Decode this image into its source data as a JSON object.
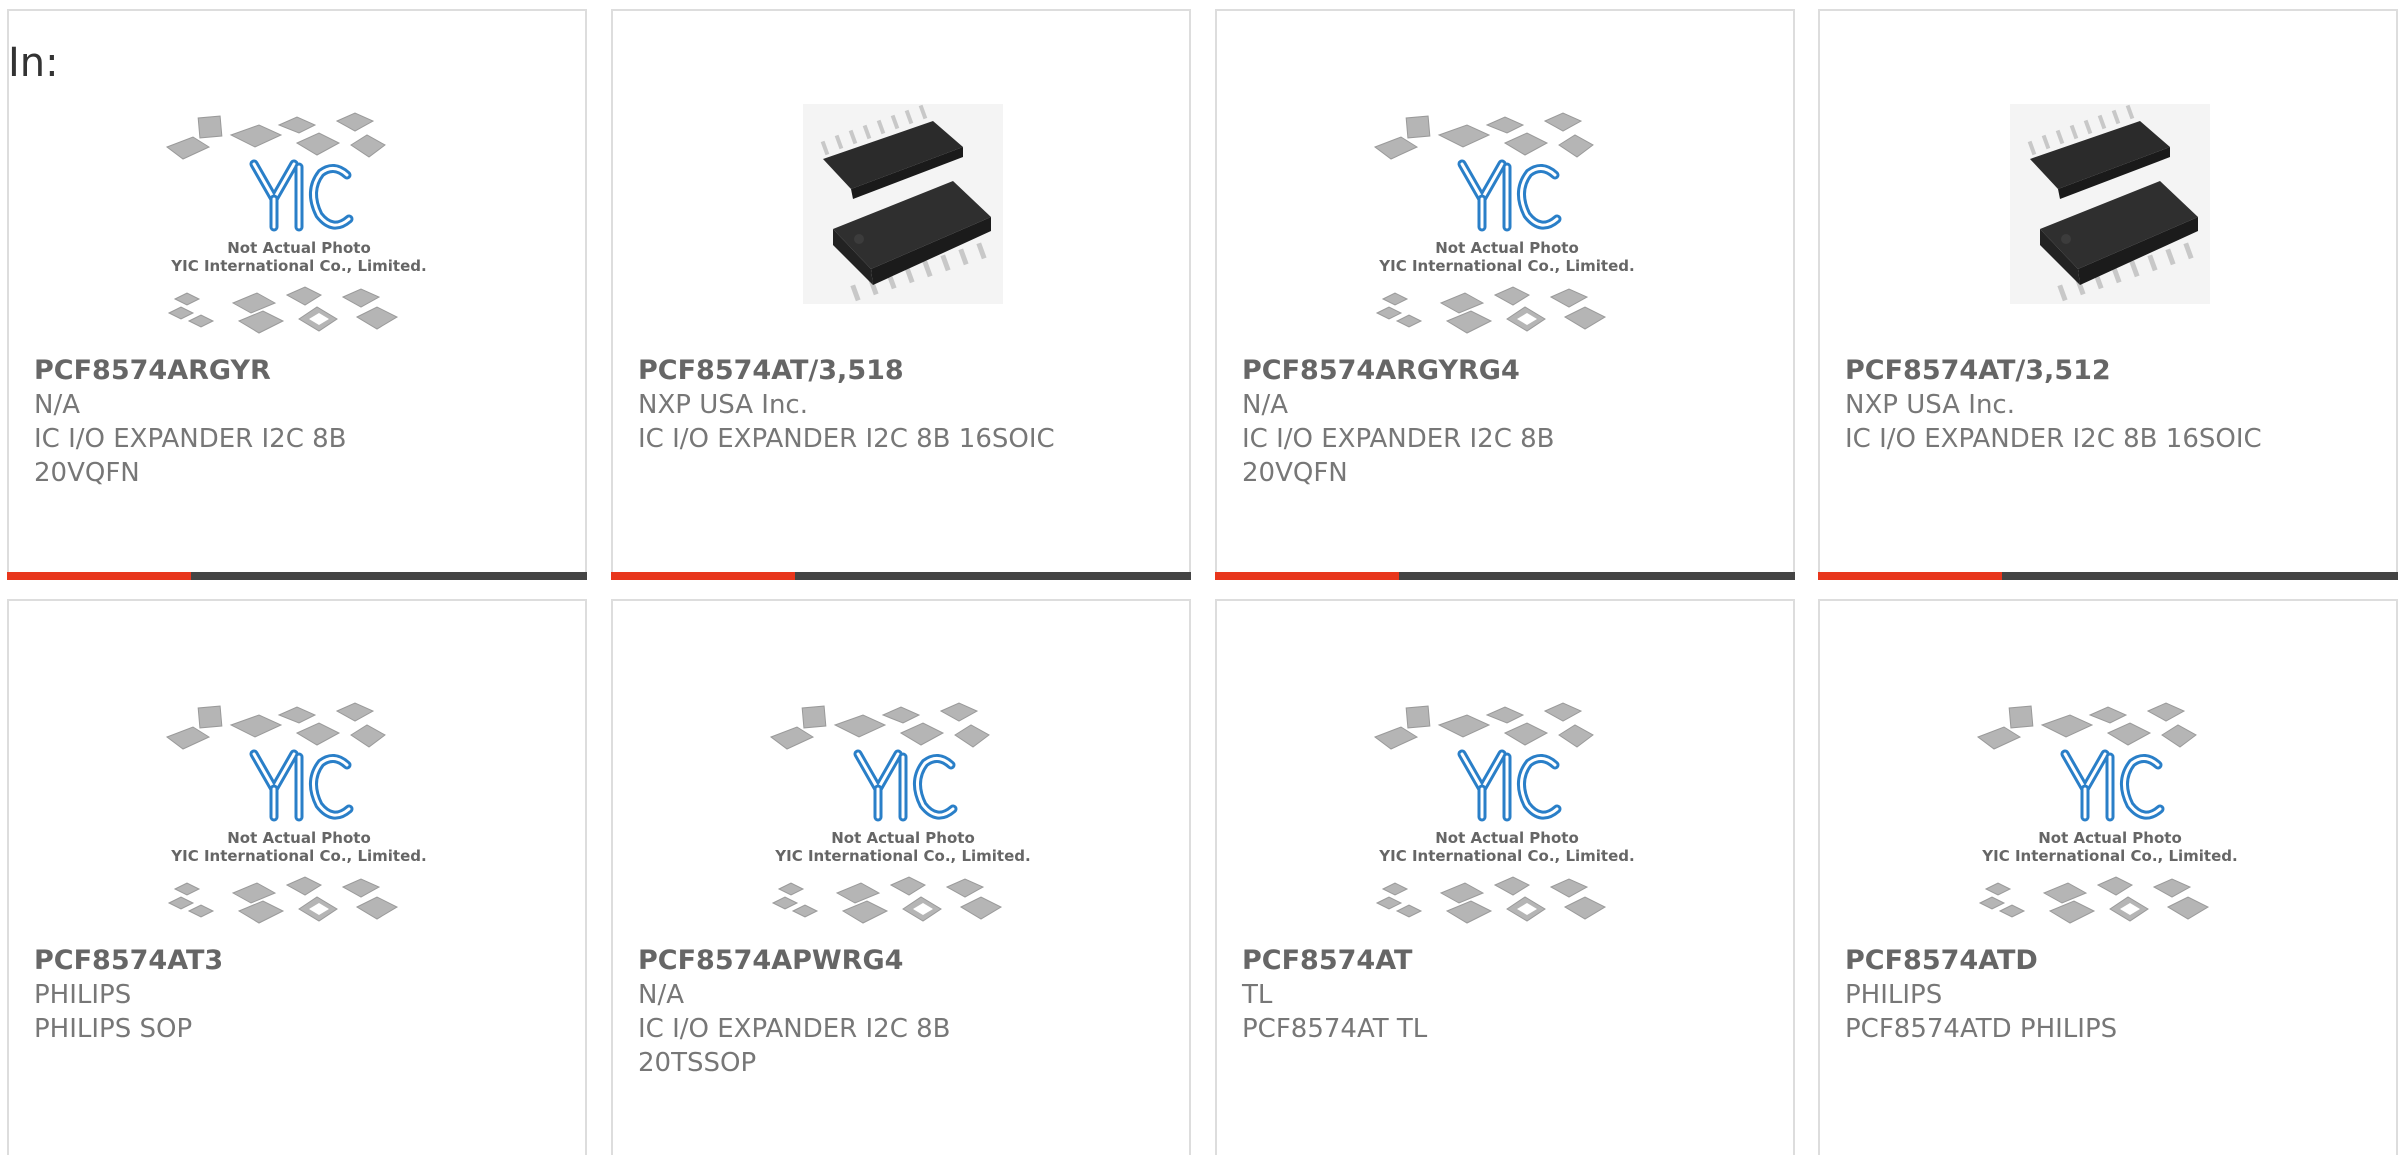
{
  "header": {
    "in_label": "In:"
  },
  "placeholder_text": {
    "line1": "Not Actual Photo",
    "line2": "YIC International Co., Limited.",
    "logo": "YIC"
  },
  "colors": {
    "accent": "#e8361c",
    "bar": "#444444",
    "logo": "#2a7fc8"
  },
  "products": [
    {
      "pn": "PCF8574ARGYR",
      "mfr": "N/A",
      "desc": "IC I/O EXPANDER I2C 8B 20VQFN",
      "image": "placeholder"
    },
    {
      "pn": "PCF8574AT/3,518",
      "mfr": "NXP USA Inc.",
      "desc": "IC I/O EXPANDER I2C 8B 16SOIC",
      "image": "soic-chip"
    },
    {
      "pn": "PCF8574ARGYRG4",
      "mfr": "N/A",
      "desc": "IC I/O EXPANDER I2C 8B 20VQFN",
      "image": "placeholder"
    },
    {
      "pn": "PCF8574AT/3,512",
      "mfr": "NXP USA Inc.",
      "desc": "IC I/O EXPANDER I2C 8B 16SOIC",
      "image": "soic-chip"
    },
    {
      "pn": "PCF8574AT3",
      "mfr": "PHILIPS",
      "desc": "PHILIPS SOP",
      "image": "placeholder"
    },
    {
      "pn": "PCF8574APWRG4",
      "mfr": "N/A",
      "desc": "IC I/O EXPANDER I2C 8B 20TSSOP",
      "image": "placeholder"
    },
    {
      "pn": "PCF8574AT",
      "mfr": "TL",
      "desc": "PCF8574AT TL",
      "image": "placeholder"
    },
    {
      "pn": "PCF8574ATD",
      "mfr": "PHILIPS",
      "desc": "PCF8574ATD PHILIPS",
      "image": "placeholder"
    }
  ]
}
